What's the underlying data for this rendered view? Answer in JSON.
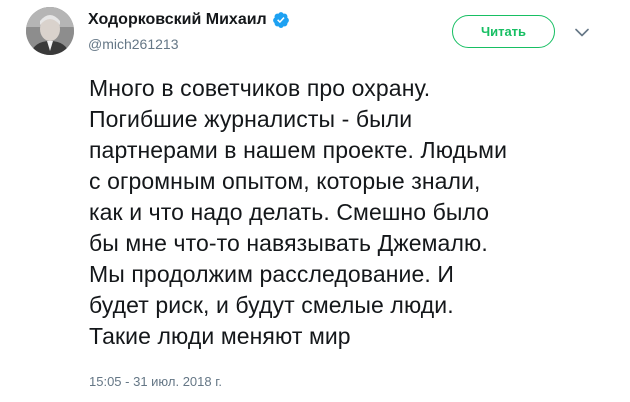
{
  "author": {
    "display_name": "Ходорковский Михаил",
    "handle": "@mich261213",
    "verified_icon": "verified-badge-icon",
    "avatar_icon": "user-avatar"
  },
  "actions": {
    "follow_label": "Читать",
    "more_icon": "chevron-down-icon"
  },
  "tweet": {
    "lines": [
      "Много в советчиков про охрану.",
      "Погибшие журналисты - были",
      "партнерами в нашем проекте. Людьми",
      "с огромным опытом, которые знали,",
      "как и что надо делать. Смешно было",
      "бы мне что-то навязывать Джемалю.",
      "Мы продолжим расследование. И",
      "будет риск, и будут смелые люди.",
      "Такие люди меняют мир"
    ],
    "timestamp": "15:05 - 31 июл. 2018 г."
  },
  "colors": {
    "follow_accent": "#17bf63",
    "verified_blue": "#1da1f2",
    "secondary_text": "#657786"
  }
}
